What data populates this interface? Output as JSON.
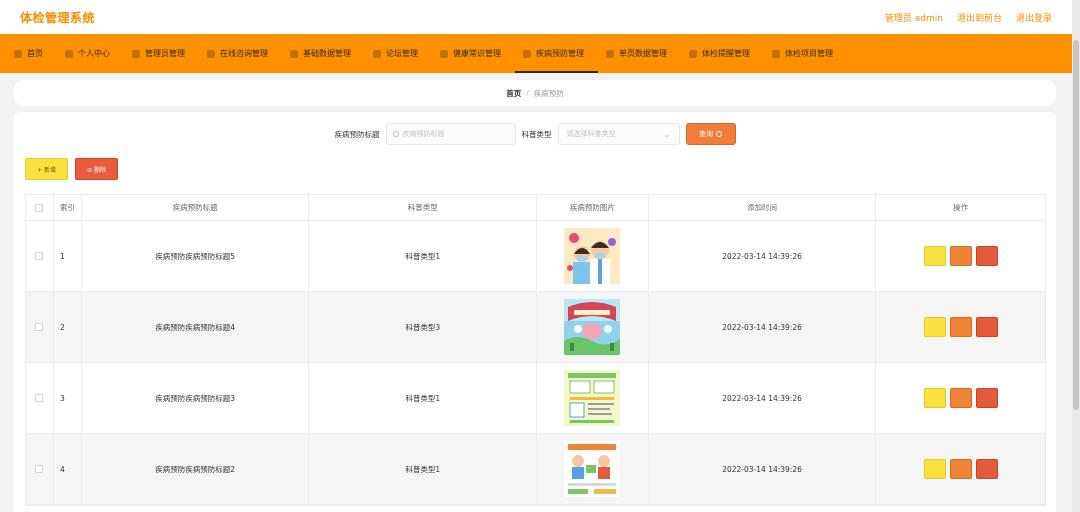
{
  "header": {
    "brand": "体检管理系统",
    "user_label": "管理员 admin",
    "front_link": "退出到前台",
    "logout_link": "退出登录"
  },
  "nav": {
    "items": [
      {
        "label": "首页",
        "icon": "home-icon"
      },
      {
        "label": "个人中心",
        "icon": "user-icon"
      },
      {
        "label": "管理员管理",
        "icon": "admin-icon"
      },
      {
        "label": "在线咨询管理",
        "icon": "chat-icon"
      },
      {
        "label": "基础数据管理",
        "icon": "database-icon"
      },
      {
        "label": "论坛管理",
        "icon": "forum-icon"
      },
      {
        "label": "健康常识管理",
        "icon": "health-icon"
      },
      {
        "label": "疾病预防管理",
        "icon": "shield-icon",
        "active": true
      },
      {
        "label": "单页数据管理",
        "icon": "page-icon"
      },
      {
        "label": "体检提醒管理",
        "icon": "bell-icon"
      },
      {
        "label": "体检项目管理",
        "icon": "list-icon"
      }
    ]
  },
  "breadcrumb": {
    "home": "首页",
    "sep": "/",
    "current": "疾病预防"
  },
  "search": {
    "title_label": "疾病预防标题",
    "title_placeholder": "疾病预防标题",
    "type_label": "科普类型",
    "type_placeholder": "请选择科普类型",
    "query_button": "查询"
  },
  "actions": {
    "add_label": "+ 新增",
    "delete_label": "⊘ 删除"
  },
  "table": {
    "columns": [
      "",
      "索引",
      "疾病预防标题",
      "科普类型",
      "疾病预防图片",
      "添加时间",
      "操作"
    ],
    "rows": [
      {
        "index": "1",
        "title": "疾病预防疾病预防标题5",
        "type": "科普类型1",
        "time": "2022-03-14 14:39:26",
        "image": "doctor-image"
      },
      {
        "index": "2",
        "title": "疾病预防疾病预防标题4",
        "type": "科普类型3",
        "time": "2022-03-14 14:39:26",
        "image": "banner-image"
      },
      {
        "index": "3",
        "title": "疾病预防疾病预防标题3",
        "type": "科普类型1",
        "time": "2022-03-14 14:39:26",
        "image": "poster-image"
      },
      {
        "index": "4",
        "title": "疾病预防疾病预防标题2",
        "type": "科普类型1",
        "time": "2022-03-14 14:39:26",
        "image": "illustration-image"
      }
    ]
  },
  "colors": {
    "accent": "#ff9000",
    "brand_text": "#ff8b00",
    "view_button": "#f9e240",
    "edit_button": "#f08436",
    "delete_button": "#e65a3c"
  }
}
